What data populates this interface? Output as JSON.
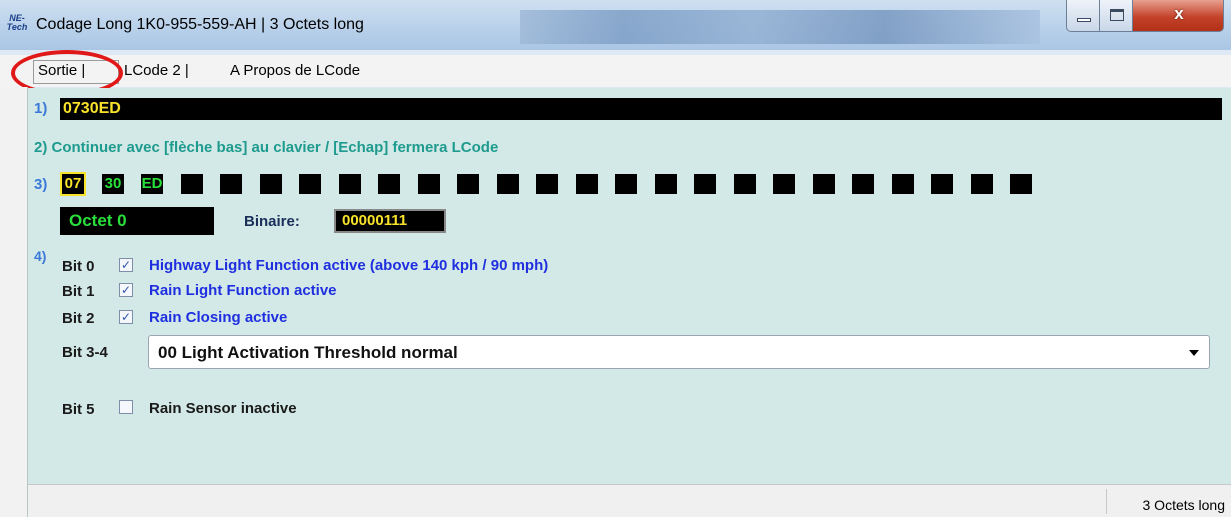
{
  "window": {
    "app_icon": [
      "NE-",
      "Tech"
    ],
    "title": "Codage Long  1K0-955-559-AH | 3 Octets long",
    "controls": {
      "close": "x"
    }
  },
  "menu": {
    "items": [
      "Sortie |",
      "LCode 2 |",
      "A Propos de LCode"
    ]
  },
  "row1": {
    "num": "1)",
    "code": "0730ED"
  },
  "row2": {
    "text": "2) Continuer avec [flèche bas] au clavier / [Echap] fermera LCode"
  },
  "row3": {
    "num": "3)",
    "bytes": [
      {
        "value": "07",
        "color": "#f8e22a"
      },
      {
        "value": "30",
        "color": "#29e03b"
      },
      {
        "value": "ED",
        "color": "#29e03b"
      }
    ],
    "empty_count": 22
  },
  "octet": {
    "label": "Octet 0",
    "binary_label": "Binaire:",
    "binary_value": "00000111"
  },
  "bits": {
    "num": "4)",
    "items": [
      {
        "label": "Bit 0",
        "checked": true,
        "desc": "Highway Light Function active (above 140 kph / 90 mph)"
      },
      {
        "label": "Bit 1",
        "checked": true,
        "desc": "Rain Light Function active"
      },
      {
        "label": "Bit 2",
        "checked": true,
        "desc": "Rain Closing active"
      }
    ],
    "select": {
      "label": "Bit 3-4",
      "value": "00 Light Activation Threshold normal"
    },
    "bit5": {
      "label": "Bit 5",
      "checked": false,
      "desc": "Rain Sensor inactive"
    }
  },
  "status": {
    "text": "3 Octets long"
  },
  "colors": {
    "content_bg": "#d3e9e7",
    "code_text": "#f8e22a",
    "green": "#29e03b",
    "bit_desc": "#1f2fe0",
    "highlight_circle": "#e01818"
  }
}
